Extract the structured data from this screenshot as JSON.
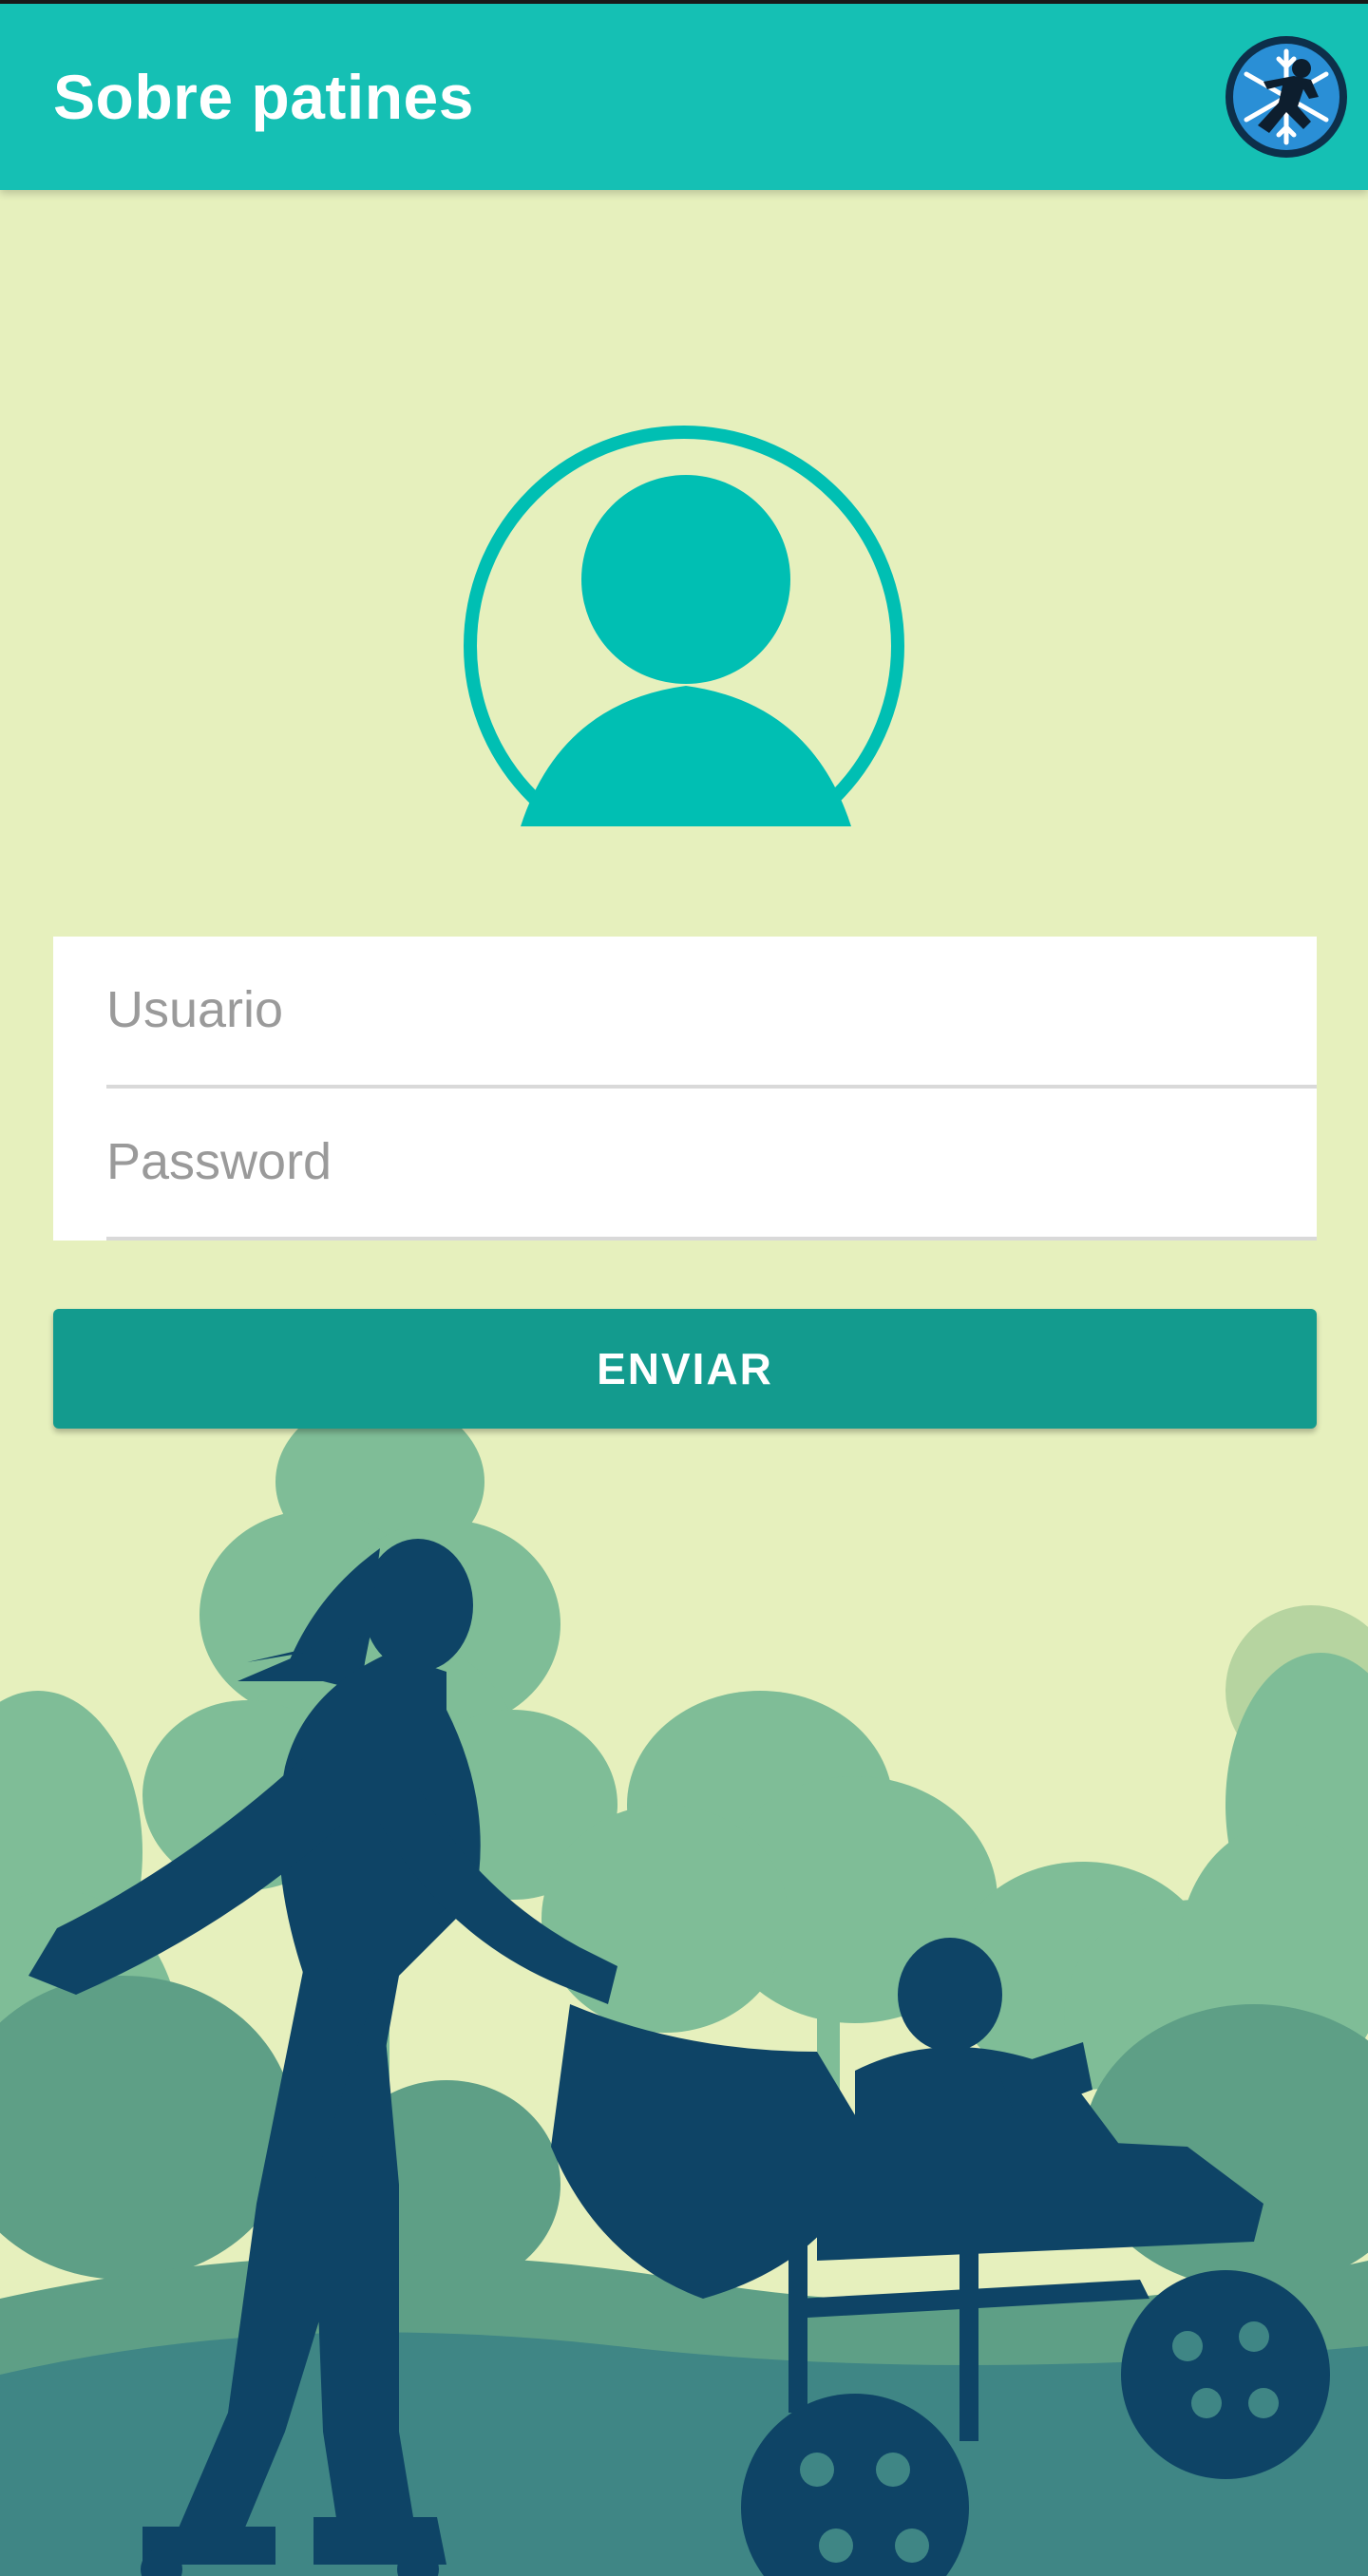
{
  "app_bar": {
    "title": "Sobre patines",
    "logo_icon": "skater-snowflake-logo-icon"
  },
  "avatar": {
    "icon": "user-avatar-icon",
    "color": "#00bfb3"
  },
  "form": {
    "username": {
      "placeholder": "Usuario",
      "value": ""
    },
    "password": {
      "placeholder": "Password",
      "value": ""
    },
    "submit_label": "ENVIAR"
  },
  "colors": {
    "app_bar": "#15c0b4",
    "background": "#e6f0bd",
    "button": "#139b8e",
    "silhouette": "#0e4466"
  },
  "background_illustration": {
    "icon": "park-skater-silhouette-illustration"
  }
}
